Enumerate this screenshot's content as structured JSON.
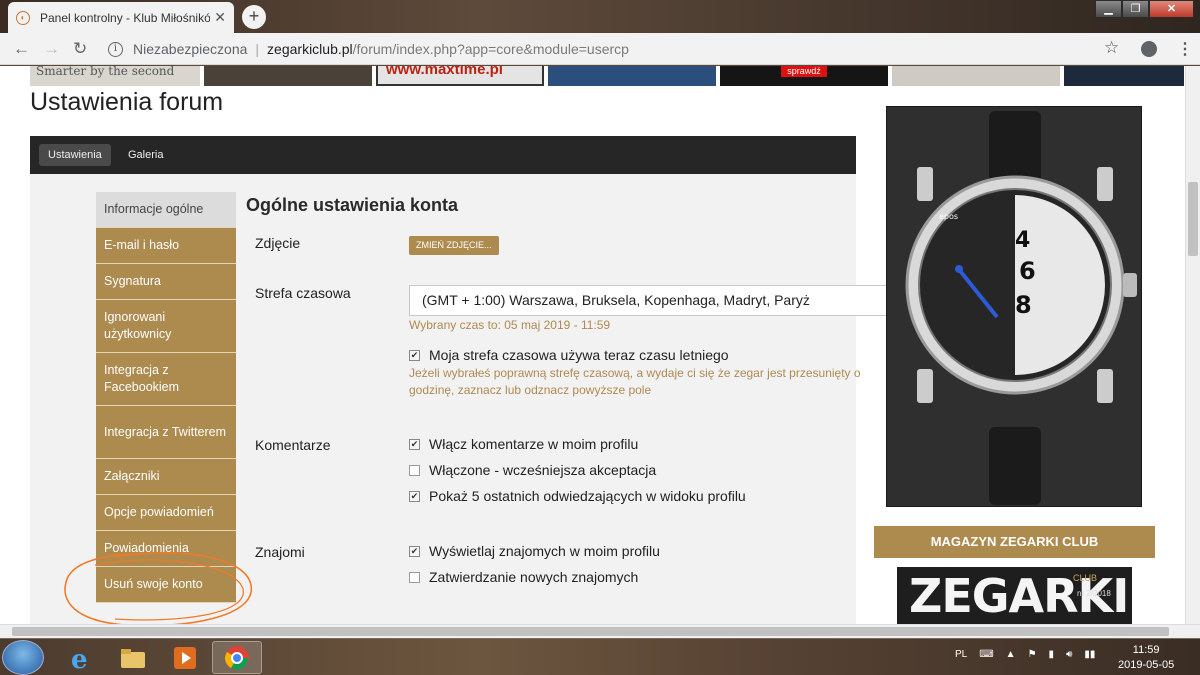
{
  "browser": {
    "tab_title": "Panel kontrolny - Klub Miłośników",
    "tab_close": "✕",
    "new_tab": "+",
    "insecure_label": "Niezabezpieczona",
    "separator": "|",
    "url_domain": "zegarkiclub.pl",
    "url_path": "/forum/index.php?app=core&module=usercp",
    "window_buttons": [
      "▁",
      "❐",
      "✕"
    ],
    "nav_icons": [
      "arrow-left-icon",
      "arrow-right-icon",
      "reload-icon"
    ]
  },
  "banner": {
    "ad1_text": "Smarter by the second",
    "ad3_text": "www.maxtime.pl",
    "ad5_text": "sprawdź"
  },
  "page": {
    "title": "Ustawienia forum",
    "tabs": [
      {
        "label": "Ustawienia",
        "active": true
      },
      {
        "label": "Galeria",
        "active": false
      }
    ],
    "sidebar": [
      {
        "label": "Informacje ogólne",
        "active": true
      },
      {
        "label": "E-mail i hasło"
      },
      {
        "label": "Sygnatura"
      },
      {
        "label": "Ignorowani użytkownicy"
      },
      {
        "label": "Integracja z Facebookiem"
      },
      {
        "label": "Integracja z Twitterem"
      },
      {
        "label": "Załączniki"
      },
      {
        "label": "Opcje powiadomień"
      },
      {
        "label": "Powiadomienia"
      },
      {
        "label": "Usuń swoje konto"
      }
    ],
    "section_title": "Ogólne ustawienia konta",
    "photo": {
      "label": "Zdjęcie",
      "button": "ZMIEŃ ZDJĘCIE..."
    },
    "timezone": {
      "label": "Strefa czasowa",
      "selected": "(GMT + 1:00) Warszawa, Bruksela, Kopenhaga, Madryt, Paryż",
      "current_time": "Wybrany czas to: 05 maj 2019 - 11:59",
      "dst_checkbox": "Moja strefa czasowa używa teraz czasu letniego",
      "dst_checked": true,
      "dst_hint": "Jeżeli wybrałeś poprawną strefę czasową, a wydaje ci się że zegar jest przesunięty o godzinę, zaznacz lub odznacz powyższe pole"
    },
    "comments": {
      "label": "Komentarze",
      "options": [
        {
          "label": "Włącz komentarze w moim profilu",
          "checked": true
        },
        {
          "label": "Włączone - wcześniejsza akceptacja",
          "checked": false
        },
        {
          "label": "Pokaż 5 ostatnich odwiedzających w widoku profilu",
          "checked": true
        }
      ]
    },
    "friends": {
      "label": "Znajomi",
      "options": [
        {
          "label": "Wyświetlaj znajomych w moim profilu",
          "checked": true
        },
        {
          "label": "Zatwierdzanie nowych znajomych",
          "checked": false
        }
      ]
    }
  },
  "right": {
    "magazine_header": "MAGAZYN ZEGARKI CLUB",
    "magazine_logo": "ZEGARKI",
    "magazine_club": "CLUB",
    "magazine_issue": "nr 2/2018"
  },
  "taskbar": {
    "lang": "PL",
    "time": "11:59",
    "date": "2019-05-05"
  },
  "colors": {
    "accent": "#ad8a4e",
    "annotation": "#f07a2a"
  }
}
